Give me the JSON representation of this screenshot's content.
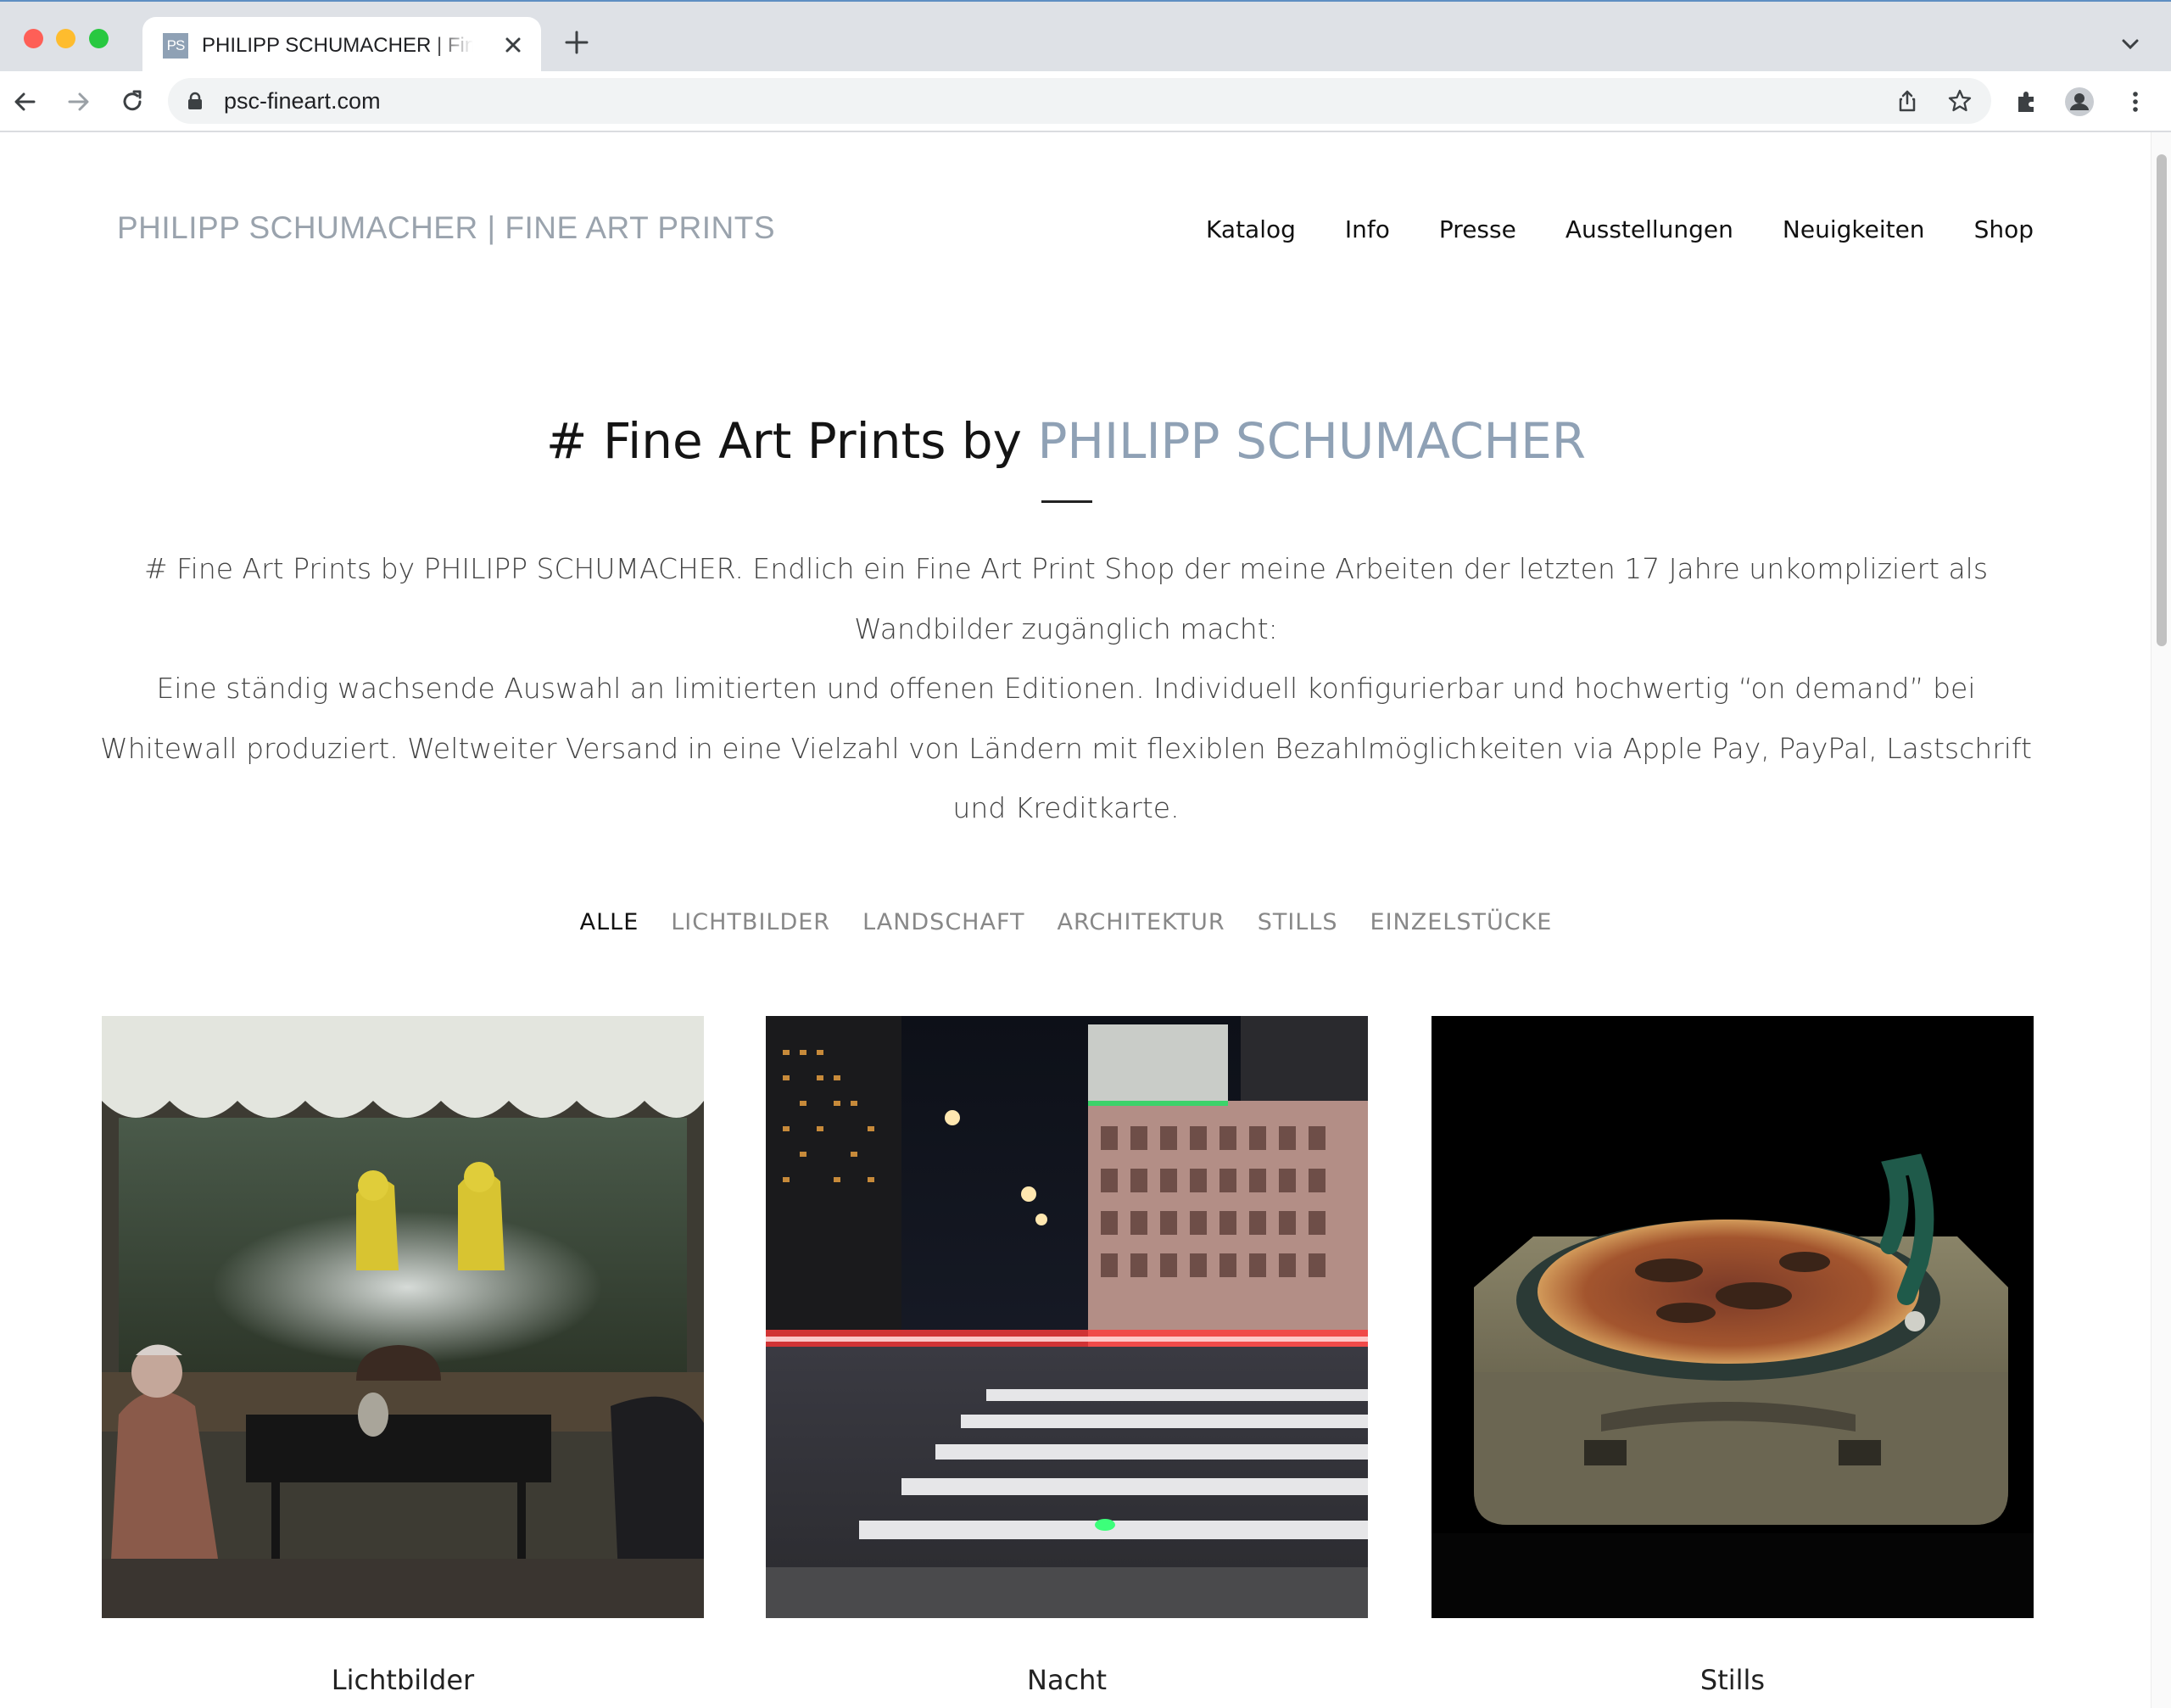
{
  "browser": {
    "tab": {
      "favicon": "PS",
      "title": "PHILIPP SCHUMACHER | Fine Art Prints"
    },
    "url": "psc-fineart.com",
    "icons": [
      "back-icon",
      "forward-icon",
      "reload-icon",
      "lock-icon",
      "share-icon",
      "star-icon",
      "extensions-icon",
      "profile-icon",
      "menu-icon",
      "close-icon",
      "plus-icon",
      "chevron-down-icon"
    ]
  },
  "site": {
    "logo": "PHILIPP SCHUMACHER | FINE ART PRINTS",
    "nav": [
      "Katalog",
      "Info",
      "Presse",
      "Ausstellungen",
      "Neuigkeiten",
      "Shop"
    ],
    "hero": {
      "title_prefix": "# Fine Art Prints by ",
      "title_name": "PHILIPP SCHUMACHER"
    },
    "intro": [
      "# Fine Art Prints by PHILIPP SCHUMACHER. Endlich ein Fine Art Print Shop der meine Arbeiten der letzten 17 Jahre unkompliziert als Wandbilder zugänglich macht:",
      "Eine ständig wachsende Auswahl an limitierten und offenen Editionen. Individuell konfigurierbar und hochwertig “on demand” bei Whitewall produziert. Weltweiter Versand in eine Vielzahl von Ländern mit flexiblen Bezahlmöglichkeiten via Apple Pay, PayPal, Lastschrift und Kreditkarte."
    ],
    "filters": [
      "ALLE",
      "LICHTBILDER",
      "LANDSCHAFT",
      "ARCHITEKTUR",
      "STILLS",
      "EINZELSTÜCKE"
    ],
    "active_filter": "ALLE",
    "gallery": [
      {
        "caption": "Lichtbilder"
      },
      {
        "caption": "Nacht"
      },
      {
        "caption": "Stills"
      }
    ]
  },
  "colors": {
    "accent": "#8fa1b5",
    "logo": "#9aa3ad",
    "chrome": "#dee1e6"
  }
}
